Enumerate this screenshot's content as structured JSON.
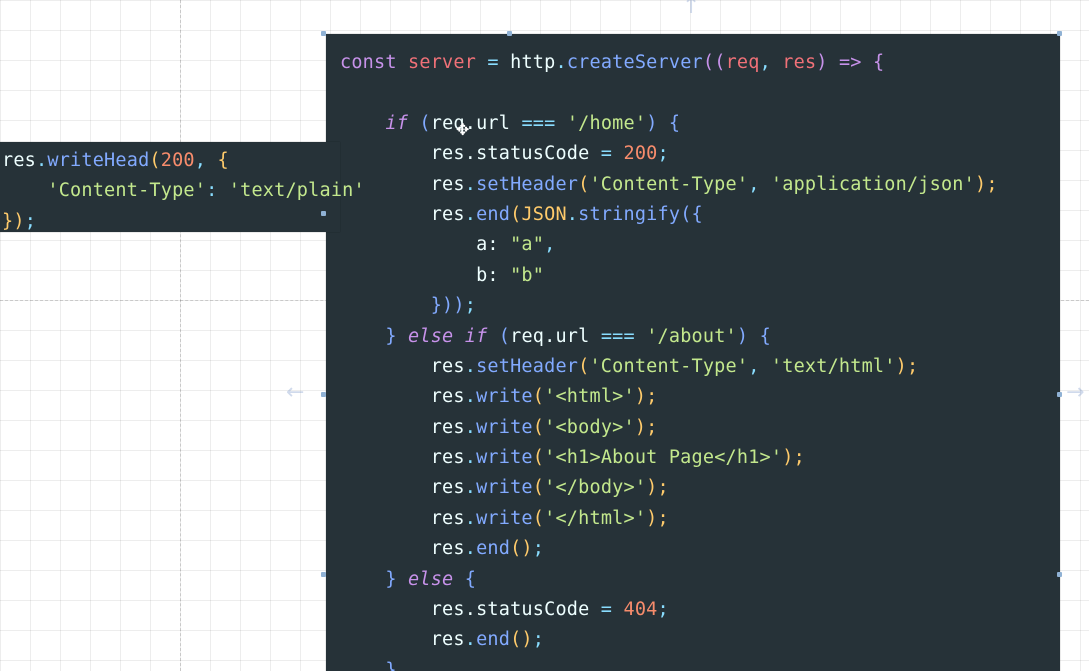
{
  "main_code": {
    "line1": {
      "kw": "const",
      "var": "server",
      "eq": "=",
      "obj": "http",
      "dot": ".",
      "fn": "createServer",
      "open": "((",
      "p1": "req",
      "comma": ",",
      "p2": "res",
      "close": ")",
      "arrow": "=>",
      "brace": "{"
    },
    "line3": {
      "kw": "if",
      "open": "(",
      "obj": "req",
      "prop": ".url",
      "op": "===",
      "str": "'/home'",
      "close": ")",
      "brace": "{"
    },
    "line4": {
      "obj": "res",
      "prop": ".statusCode",
      "eq": "=",
      "num": "200",
      "semi": ";"
    },
    "line5": {
      "obj": "res",
      "dot": ".",
      "fn": "setHeader",
      "open": "(",
      "str1": "'Content-Type'",
      "comma": ",",
      "str2": "'application/json'",
      "close": ");"
    },
    "line6": {
      "obj": "res",
      "dot": ".",
      "fn": "end",
      "open": "(",
      "jobj": "JSON",
      "dot2": ".",
      "fn2": "stringify",
      "open2": "({"
    },
    "line7": {
      "key": "a:",
      "str": "\"a\"",
      "comma": ","
    },
    "line8": {
      "key": "b:",
      "str": "\"b\""
    },
    "line9": {
      "close": "}))",
      "semi": ";"
    },
    "line10": {
      "brace": "}",
      "kw": "else if",
      "open": "(",
      "obj": "req",
      "prop": ".url",
      "op": "===",
      "str": "'/about'",
      "close": ")",
      "brace2": "{"
    },
    "line11": {
      "obj": "res",
      "dot": ".",
      "fn": "setHeader",
      "open": "(",
      "str1": "'Content-Type'",
      "comma": ",",
      "str2": "'text/html'",
      "close": ");"
    },
    "line12": {
      "obj": "res",
      "dot": ".",
      "fn": "write",
      "open": "(",
      "str": "'<html>'",
      "close": ");"
    },
    "line13": {
      "obj": "res",
      "dot": ".",
      "fn": "write",
      "open": "(",
      "str": "'<body>'",
      "close": ");"
    },
    "line14": {
      "obj": "res",
      "dot": ".",
      "fn": "write",
      "open": "(",
      "str": "'<h1>About Page</h1>'",
      "close": ");"
    },
    "line15": {
      "obj": "res",
      "dot": ".",
      "fn": "write",
      "open": "(",
      "str": "'</body>'",
      "close": ");"
    },
    "line16": {
      "obj": "res",
      "dot": ".",
      "fn": "write",
      "open": "(",
      "str": "'</html>'",
      "close": ");"
    },
    "line17": {
      "obj": "res",
      "dot": ".",
      "fn": "end",
      "call": "()",
      "semi": ";"
    },
    "line18": {
      "brace": "}",
      "kw": "else",
      "brace2": "{"
    },
    "line19": {
      "obj": "res",
      "prop": ".statusCode",
      "eq": "=",
      "num": "404",
      "semi": ";"
    },
    "line20": {
      "obj": "res",
      "dot": ".",
      "fn": "end",
      "call": "()",
      "semi": ";"
    },
    "line21": {
      "brace": "}"
    }
  },
  "side_code": {
    "line1": {
      "obj": "res",
      "dot": ".",
      "fn": "writeHead",
      "open": "(",
      "num": "200",
      "comma": ",",
      "brace": "{"
    },
    "line2": {
      "str1": "'Content-Type'",
      "colon": ":",
      "str2": "'text/plain'"
    },
    "line3": {
      "close": "})",
      "semi": ";"
    }
  },
  "colors": {
    "panel_bg": "#263238",
    "keyword": "#c792ea",
    "variable": "#f07178",
    "function": "#82aaff",
    "string": "#c3e88d",
    "number": "#f78c6c",
    "operator": "#89ddff"
  },
  "icons": [
    "move-arrow-up-icon",
    "move-arrow-left-icon",
    "move-arrow-right-icon",
    "text-cursor-icon",
    "resize-handle-icon"
  ]
}
